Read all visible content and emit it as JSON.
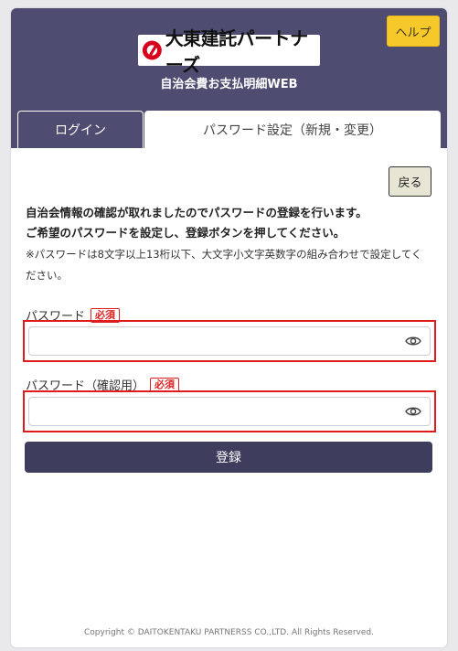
{
  "header": {
    "help_label": "ヘルプ",
    "logo_text": "大東建託パートナーズ",
    "app_title": "自治会費お支払明細WEB"
  },
  "tabs": [
    {
      "label": "ログイン",
      "active": false
    },
    {
      "label": "パスワード設定（新規・変更）",
      "active": true
    }
  ],
  "back_label": "戻る",
  "info": {
    "line1": "自治会情報の確認が取れましたのでパスワードの登録を行います。",
    "line2": "ご希望のパスワードを設定し、登録ボタンを押してください。",
    "note_line1": "※パスワードは8文字以上13桁以下、大文字小文字英数字の組み合わせで設定してく",
    "note_line2": "ださい。"
  },
  "fields": [
    {
      "label": "パスワード",
      "required": "必須",
      "value": ""
    },
    {
      "label": "パスワード（確認用）",
      "required": "必須",
      "value": ""
    }
  ],
  "submit_label": "登録",
  "footer": "Copyright © DAITOKENTAKU PARTNERSS CO.,LTD. All Rights Reserved.",
  "colors": {
    "header_bg": "#4f4c72",
    "help_bg": "#f7c829",
    "required_red": "#d22222",
    "button_bg": "#3f3d5d"
  }
}
